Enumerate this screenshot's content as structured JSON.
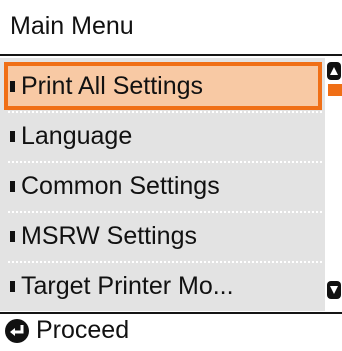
{
  "header": {
    "title": "Main Menu"
  },
  "menu": {
    "items": [
      {
        "label": "Print All Settings",
        "selected": true
      },
      {
        "label": "Language",
        "selected": false
      },
      {
        "label": "Common Settings",
        "selected": false
      },
      {
        "label": "MSRW Settings",
        "selected": false
      },
      {
        "label": "Target Printer Mo...",
        "selected": false
      }
    ]
  },
  "footer": {
    "action_label": "Proceed",
    "action_icon": "enter-key-icon"
  },
  "colors": {
    "accent": "#f06f16",
    "selection_fill": "#f8c9a4",
    "menu_background": "#e3e3e3"
  }
}
